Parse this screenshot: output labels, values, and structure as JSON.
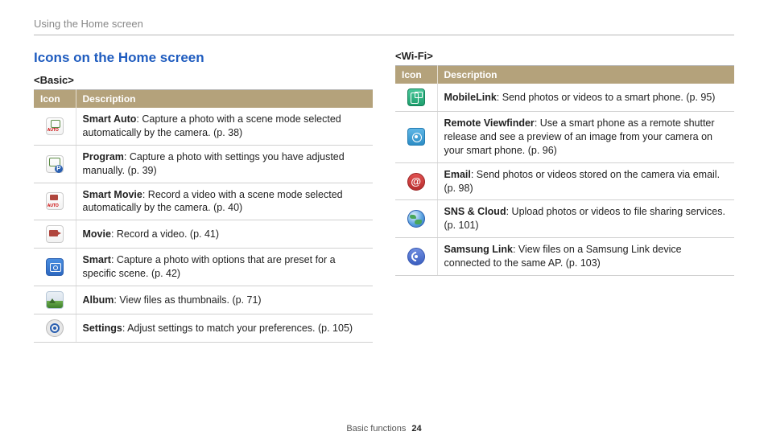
{
  "breadcrumb": "Using the Home screen",
  "section_title": "Icons on the Home screen",
  "basic": {
    "heading": "<Basic>",
    "col_icon": "Icon",
    "col_desc": "Description",
    "rows": [
      {
        "icon_class": "ico-smart-auto",
        "icon_name": "smart-auto-icon",
        "term": "Smart Auto",
        "text": ": Capture a photo with a scene mode selected automatically by the camera. (p. 38)"
      },
      {
        "icon_class": "ico-program",
        "icon_name": "program-icon",
        "term": "Program",
        "text": ": Capture a photo with settings you have adjusted manually. (p. 39)"
      },
      {
        "icon_class": "ico-smart-movie",
        "icon_name": "smart-movie-icon",
        "term": "Smart Movie",
        "text": ": Record a video with a scene mode selected automatically by the camera. (p. 40)"
      },
      {
        "icon_class": "ico-movie",
        "icon_name": "movie-icon",
        "term": "Movie",
        "text": ": Record a video. (p. 41)"
      },
      {
        "icon_class": "ico-smart",
        "icon_name": "smart-icon",
        "term": "Smart",
        "text": ": Capture a photo with options that are preset for a specific scene. (p. 42)"
      },
      {
        "icon_class": "ico-album",
        "icon_name": "album-icon",
        "term": "Album",
        "text": ": View files as thumbnails. (p. 71)"
      },
      {
        "icon_class": "ico-settings",
        "icon_name": "settings-icon",
        "term": "Settings",
        "text": ": Adjust settings to match your preferences. (p. 105)"
      }
    ]
  },
  "wifi": {
    "heading": "<Wi-Fi>",
    "col_icon": "Icon",
    "col_desc": "Description",
    "rows": [
      {
        "icon_class": "ico-mobilelink",
        "icon_name": "mobilelink-icon",
        "term": "MobileLink",
        "text": ": Send photos or videos to a smart phone. (p. 95)"
      },
      {
        "icon_class": "ico-remote",
        "icon_name": "remote-viewfinder-icon",
        "term": "Remote Viewfinder",
        "text": ": Use a smart phone as a remote shutter release and see a preview of an image from your camera on your smart phone. (p. 96)"
      },
      {
        "icon_class": "ico-email",
        "icon_name": "email-icon",
        "term": "Email",
        "text": ": Send photos or videos stored on the camera via email. (p. 98)"
      },
      {
        "icon_class": "ico-sns",
        "icon_name": "sns-cloud-icon",
        "term": "SNS & Cloud",
        "text": ": Upload photos or videos to file sharing services. (p. 101)"
      },
      {
        "icon_class": "ico-samsunglink",
        "icon_name": "samsung-link-icon",
        "term": "Samsung Link",
        "text": ": View files on a Samsung Link device connected to the same AP. (p. 103)"
      }
    ]
  },
  "footer": {
    "section": "Basic functions",
    "page": "24"
  }
}
